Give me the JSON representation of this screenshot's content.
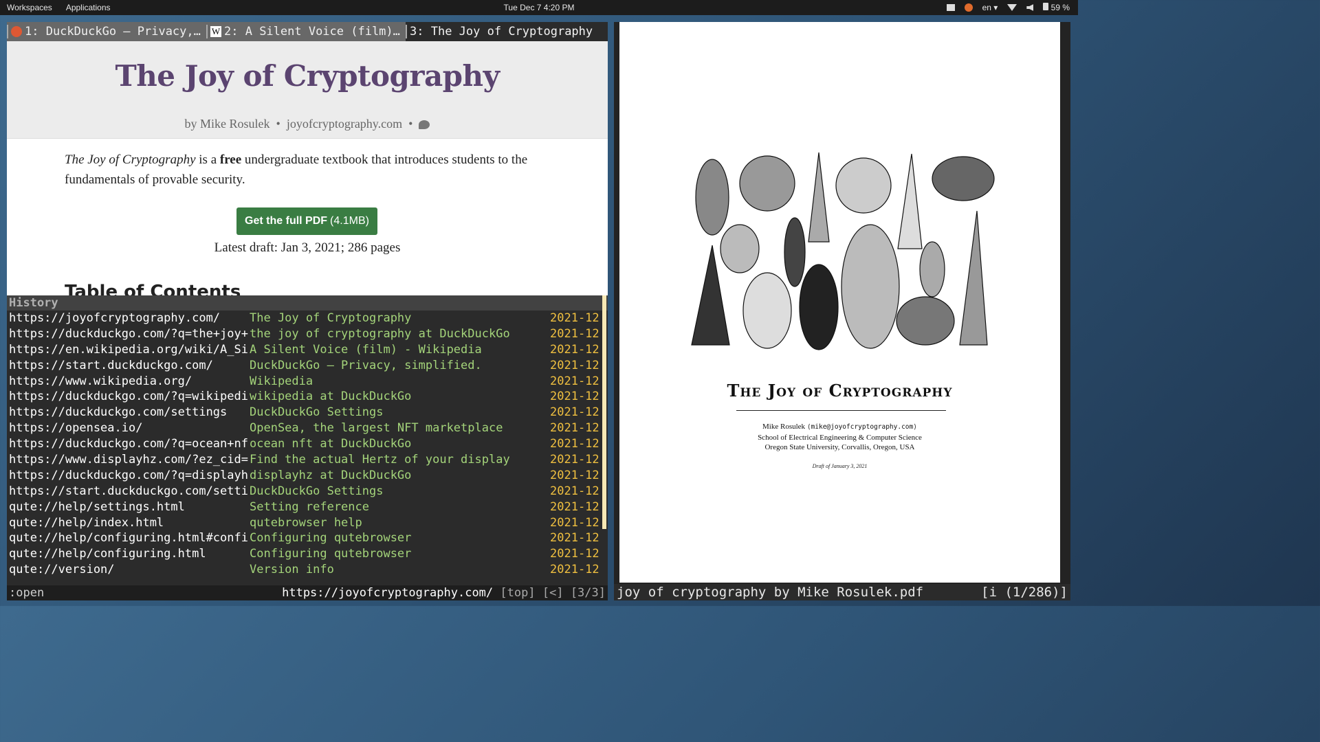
{
  "topbar": {
    "workspaces": "Workspaces",
    "applications": "Applications",
    "clock": "Tue Dec 7   4:20 PM",
    "lang": "en",
    "battery": "59 %"
  },
  "browser": {
    "tabs": [
      {
        "label": "1: DuckDuckGo — Privacy,…",
        "favicon": "duckduckgo-icon"
      },
      {
        "label": "2: A Silent Voice (film)…",
        "favicon": "wikipedia-icon",
        "favicon_glyph": "W"
      },
      {
        "label": "3: The Joy of Cryptography"
      }
    ],
    "page": {
      "title": "The Joy of Cryptography",
      "byline_author": "by Mike Rosulek",
      "byline_site": "joyofcryptography.com",
      "sep": "•",
      "intro_italic": "The Joy of Cryptography",
      "intro_a": " is a ",
      "intro_bold": "free",
      "intro_b": " undergraduate textbook that introduces students to the fundamentals of provable security.",
      "pdf_button": "Get the full PDF",
      "pdf_size": "(4.1MB)",
      "draft": "Latest draft: Jan 3, 2021; 286 pages",
      "toc": "Table of Contents"
    },
    "history": {
      "header": "History",
      "rows": [
        {
          "url": "https://joyofcryptography.com/",
          "title": "The Joy of Cryptography",
          "date": "2021-12"
        },
        {
          "url": "https://duckduckgo.com/?q=the+joy+",
          "title": "the joy of cryptography at DuckDuckGo",
          "date": "2021-12"
        },
        {
          "url": "https://en.wikipedia.org/wiki/A_Si",
          "title": "A Silent Voice (film) - Wikipedia",
          "date": "2021-12"
        },
        {
          "url": "https://start.duckduckgo.com/",
          "title": "DuckDuckGo — Privacy, simplified.",
          "date": "2021-12"
        },
        {
          "url": "https://www.wikipedia.org/",
          "title": "Wikipedia",
          "date": "2021-12"
        },
        {
          "url": "https://duckduckgo.com/?q=wikipedi",
          "title": "wikipedia at DuckDuckGo",
          "date": "2021-12"
        },
        {
          "url": "https://duckduckgo.com/settings",
          "title": "DuckDuckGo Settings",
          "date": "2021-12"
        },
        {
          "url": "https://opensea.io/",
          "title": "OpenSea, the largest NFT marketplace",
          "date": "2021-12"
        },
        {
          "url": "https://duckduckgo.com/?q=ocean+nf",
          "title": "ocean nft at DuckDuckGo",
          "date": "2021-12"
        },
        {
          "url": "https://www.displayhz.com/?ez_cid=",
          "title": "Find the actual Hertz of your display",
          "date": "2021-12"
        },
        {
          "url": "https://duckduckgo.com/?q=displayh",
          "title": "displayhz at DuckDuckGo",
          "date": "2021-12"
        },
        {
          "url": "https://start.duckduckgo.com/setti",
          "title": "DuckDuckGo Settings",
          "date": "2021-12"
        },
        {
          "url": "qute://help/settings.html",
          "title": "Setting reference",
          "date": "2021-12"
        },
        {
          "url": "qute://help/index.html",
          "title": "qutebrowser help",
          "date": "2021-12"
        },
        {
          "url": "qute://help/configuring.html#confi",
          "title": "Configuring qutebrowser",
          "date": "2021-12"
        },
        {
          "url": "qute://help/configuring.html",
          "title": "Configuring qutebrowser",
          "date": "2021-12"
        },
        {
          "url": "qute://version/",
          "title": "Version info",
          "date": "2021-12"
        }
      ]
    },
    "statusbar": {
      "command": ":open",
      "url": "https://joyofcryptography.com/",
      "scroll": "[top]",
      "history_nav": "[<]",
      "tab_pos": "[3/3]"
    }
  },
  "pdf": {
    "title": "The Joy of Cryptography",
    "author": "Mike Rosulek",
    "email": "⟨mike@joyofcryptography.com⟩",
    "school": "School of Electrical Engineering & Computer Science",
    "university": "Oregon State University, Corvallis, Oregon, USA",
    "draft": "Draft of January 3, 2021",
    "filename": "joy of cryptography by Mike Rosulek.pdf",
    "page_indicator": "[i (1/286)]"
  }
}
